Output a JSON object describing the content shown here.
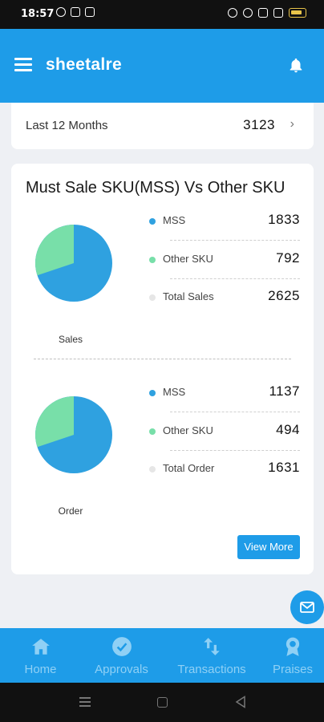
{
  "status_bar": {
    "time": "18:57"
  },
  "app_bar": {
    "title": "sheetalre"
  },
  "summary": {
    "period": "Last 12 Months",
    "count": "3123"
  },
  "mss_card": {
    "title": "Must Sale SKU(MSS) Vs Other SKU",
    "sales": {
      "label": "Sales",
      "rows": [
        {
          "name": "MSS",
          "value": "1833",
          "color": "#2fa1e0"
        },
        {
          "name": "Other SKU",
          "value": "792",
          "color": "#78dfa9"
        },
        {
          "name": "Total Sales",
          "value": "2625",
          "color": "#e6e6e6"
        }
      ]
    },
    "order": {
      "label": "Order",
      "rows": [
        {
          "name": "MSS",
          "value": "1137",
          "color": "#2fa1e0"
        },
        {
          "name": "Other SKU",
          "value": "494",
          "color": "#78dfa9"
        },
        {
          "name": "Total Order",
          "value": "1631",
          "color": "#e6e6e6"
        }
      ]
    },
    "view_more_label": "View More"
  },
  "bottom_nav": [
    {
      "label": "Home",
      "icon": "home-icon"
    },
    {
      "label": "Approvals",
      "icon": "check-circle-icon"
    },
    {
      "label": "Transactions",
      "icon": "transfer-arrows-icon"
    },
    {
      "label": "Praises",
      "icon": "award-icon"
    }
  ],
  "colors": {
    "primary": "#1e9ce8",
    "mss": "#2fa1e0",
    "other_sku": "#78dfa9"
  }
}
